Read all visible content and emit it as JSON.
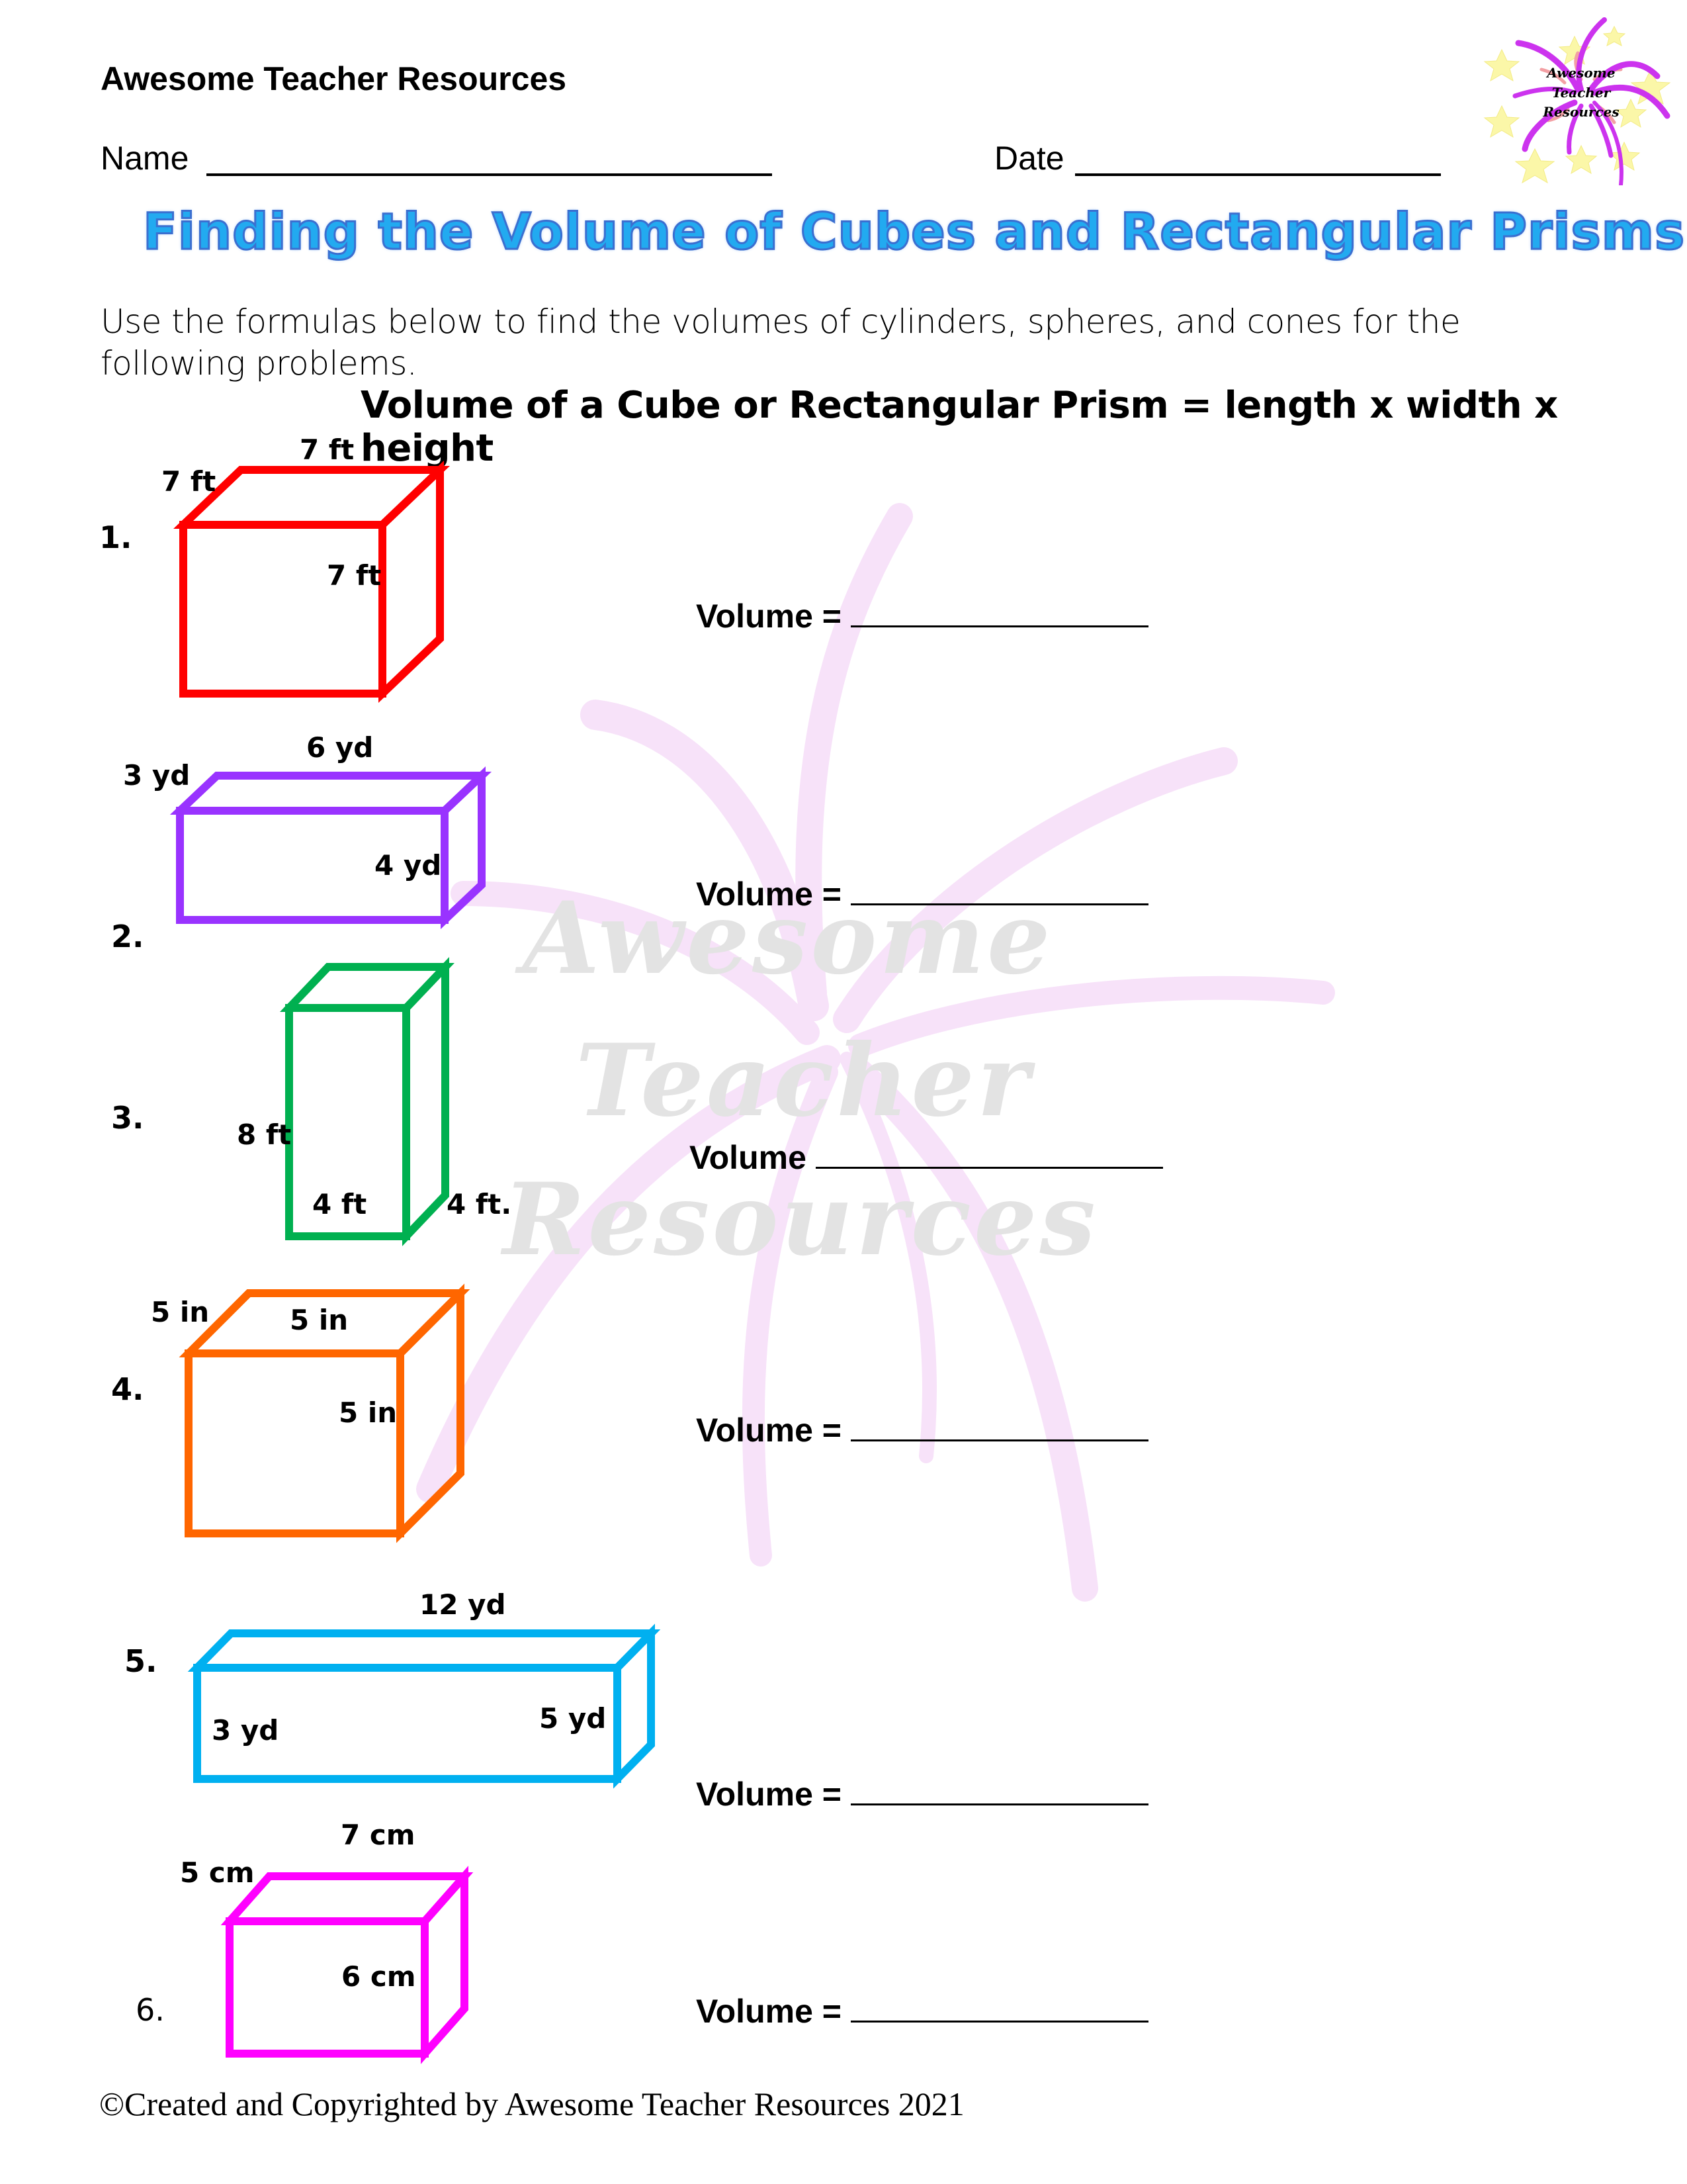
{
  "header": {
    "brand": "Awesome Teacher Resources",
    "name_label": "Name",
    "date_label": "Date",
    "logo": {
      "icon": "fireworks-logo-icon",
      "lines": [
        "Awesome",
        "Teacher",
        "Resources"
      ],
      "colors": {
        "burst": "#cc33ee",
        "stars": "#fbf7a8",
        "sparks": "#f4a0a0"
      }
    }
  },
  "title": "Finding the Volume of Cubes and Rectangular Prisms",
  "title_color": "#22aaf0",
  "instructions": "Use the formulas below to find the volumes of cylinders, spheres, and cones for the following problems.",
  "formula": "Volume of a Cube or Rectangular Prism = length x width x height",
  "watermark": [
    "Awesome",
    "Teacher",
    "Resources"
  ],
  "problems": [
    {
      "number": "1.",
      "color": "#ff0000",
      "shape": "cube",
      "labels": {
        "top": "7 ft",
        "side": "7 ft",
        "front": "7 ft"
      },
      "answer_label": "Volume ="
    },
    {
      "number": "2.",
      "color": "#9933ff",
      "shape": "rectangular-prism",
      "labels": {
        "top": "6 yd",
        "side": "3 yd",
        "front": "4 yd"
      },
      "answer_label": "Volume ="
    },
    {
      "number": "3.",
      "color": "#00b050",
      "shape": "rectangular-prism",
      "labels": {
        "height": "8 ft",
        "bottom": "4 ft",
        "depth": "4 ft."
      },
      "answer_label": "Volume"
    },
    {
      "number": "4.",
      "color": "#ff6600",
      "shape": "cube",
      "labels": {
        "side": "5 in",
        "top": "5 in",
        "front": "5 in"
      },
      "answer_label": "Volume ="
    },
    {
      "number": "5.",
      "color": "#00b0f0",
      "shape": "rectangular-prism",
      "labels": {
        "top": "12 yd",
        "left": "3 yd",
        "right": "5 yd"
      },
      "answer_label": "Volume ="
    },
    {
      "number": "6.",
      "color": "#ff00ff",
      "shape": "rectangular-prism",
      "labels": {
        "top": "7 cm",
        "side": "5 cm",
        "front": "6 cm"
      },
      "answer_label": "Volume ="
    }
  ],
  "footer": "©Created and Copyrighted by Awesome Teacher Resources 2021"
}
